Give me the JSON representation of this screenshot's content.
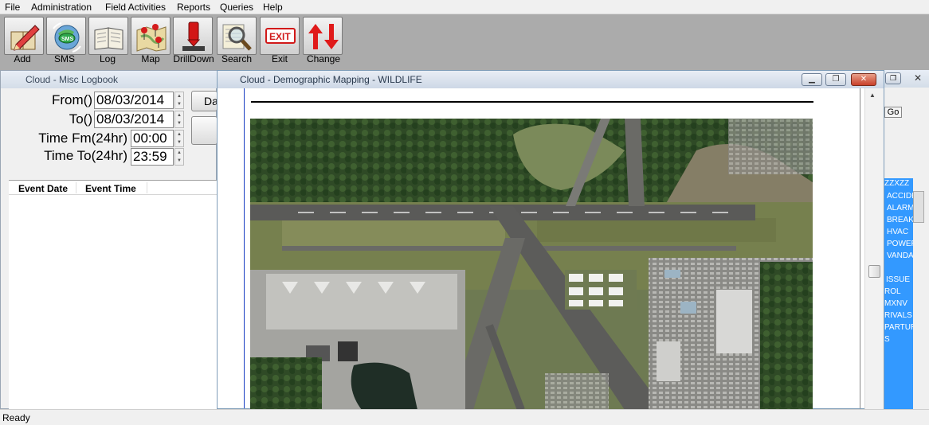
{
  "menu": {
    "items": [
      "File",
      "Administration",
      "Field Activities",
      "Reports",
      "Queries",
      "Help"
    ]
  },
  "toolbar": {
    "buttons": [
      {
        "label": "Add",
        "icon": "pencil-book-icon"
      },
      {
        "label": "SMS",
        "icon": "sms-globe-icon"
      },
      {
        "label": "Log",
        "icon": "open-book-icon"
      },
      {
        "label": "Map",
        "icon": "map-pins-icon"
      },
      {
        "label": "DrillDown",
        "icon": "drill-down-icon"
      },
      {
        "label": "Search",
        "icon": "magnifier-icon"
      },
      {
        "label": "Exit",
        "icon": "exit-sign-icon",
        "badge": "EXIT"
      },
      {
        "label": "Change",
        "icon": "up-down-arrows-icon"
      }
    ]
  },
  "log_window": {
    "title": "Cloud - Misc Logbook",
    "from_label": "From()",
    "from_value": "08/03/2014",
    "to_label": "To()",
    "to_value": "08/03/2014",
    "time_from_label": "Time Fm(24hr)",
    "time_from_value": "00:00",
    "time_to_label": "Time To(24hr)",
    "time_to_value": "23:59",
    "button1_label": "Da",
    "columns": [
      "Event Date",
      "Event Time"
    ]
  },
  "map_window": {
    "title": "Cloud - Demographic Mapping - WILDLIFE",
    "image_subject": "aerial airport runway photo"
  },
  "right_window": {
    "go_label": "Go",
    "list_items": [
      "ZZXZZ",
      "ACCIDE",
      "ALARM",
      "BREAK",
      "HVAC",
      "POWER",
      "VANDA",
      "ISSUE",
      "ROL",
      "MXNV",
      "RIVALS",
      "PARTUR",
      "S"
    ]
  },
  "status": {
    "text": "Ready"
  },
  "colors": {
    "toolbar_bg": "#ababab",
    "list_highlight": "#3399ff",
    "exit_red": "#d11a1a"
  }
}
